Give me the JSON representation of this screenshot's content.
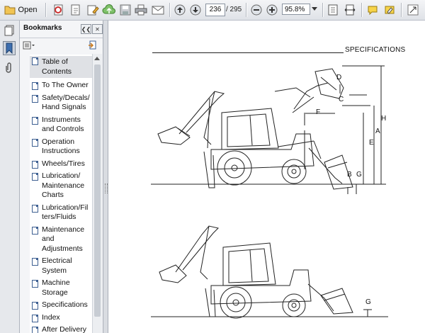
{
  "toolbar": {
    "open_label": "Open",
    "page_current": "236",
    "page_total": "/ 295",
    "zoom": "95.8%"
  },
  "panel": {
    "title": "Bookmarks"
  },
  "bookmarks": [
    {
      "label": "Table of Contents"
    },
    {
      "label": "To The Owner"
    },
    {
      "label": "Safety/Decals/ Hand Signals"
    },
    {
      "label": "Instruments and Controls"
    },
    {
      "label": "Operation Instructions"
    },
    {
      "label": "Wheels/Tires"
    },
    {
      "label": "Lubrication/ Maintenance Charts"
    },
    {
      "label": "Lubrication/Fil ters/Fluids"
    },
    {
      "label": "Maintenance and Adjustments"
    },
    {
      "label": "Electrical System"
    },
    {
      "label": "Machine Storage"
    },
    {
      "label": "Specifications"
    },
    {
      "label": "Index"
    },
    {
      "label": "After Delivery"
    }
  ],
  "document": {
    "section_title": "SPECIFICATIONS",
    "dims_top": {
      "d": "D",
      "c": "C",
      "f": "F",
      "h": "H",
      "a": "A",
      "e": "E",
      "b": "B",
      "g": "G"
    },
    "dims_bottom": {
      "g": "G"
    }
  },
  "colors": {
    "accent": "#3d5f91",
    "selection": "#dfe1e5"
  }
}
